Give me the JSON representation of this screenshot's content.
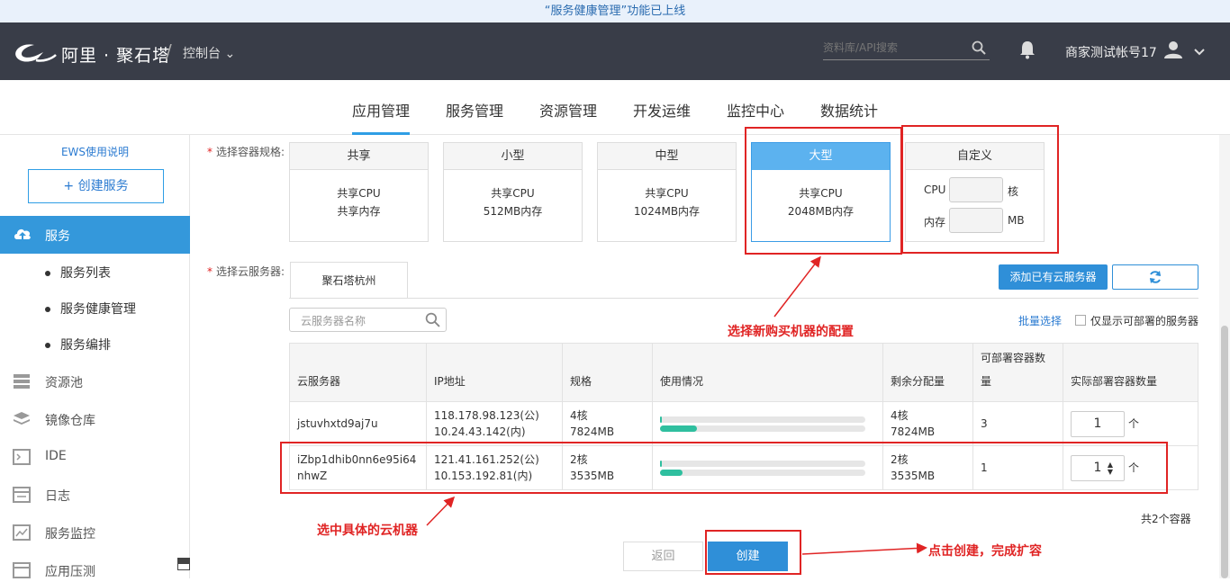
{
  "notice": "“服务健康管理”功能已上线",
  "header": {
    "brand": "阿里 · 聚石塔",
    "separator": "/",
    "console": "控制台",
    "search_placeholder": "资料库/API搜索",
    "account": "商家测试帐号17",
    "icons": [
      "alibaba-logo",
      "chevron-down-icon",
      "search-icon",
      "bell-icon",
      "user-icon",
      "chevron-down-icon"
    ]
  },
  "nav": {
    "tabs": [
      "应用管理",
      "服务管理",
      "资源管理",
      "开发运维",
      "监控中心",
      "数据统计"
    ],
    "active": "应用管理"
  },
  "sidebar": {
    "ews_link": "EWS使用说明",
    "create_button": "+ 创建服务",
    "service": "服务",
    "sub_items": [
      "服务列表",
      "服务健康管理",
      "服务编排"
    ],
    "items": [
      "资源池",
      "镜像仓库",
      "IDE",
      "日志",
      "服务监控",
      "应用压测"
    ]
  },
  "spec": {
    "label": "选择容器规格:",
    "cards": [
      {
        "title": "共享",
        "line1": "共享CPU",
        "line2": "共享内存"
      },
      {
        "title": "小型",
        "line1": "共享CPU",
        "line2": "512MB内存"
      },
      {
        "title": "中型",
        "line1": "共享CPU",
        "line2": "1024MB内存"
      },
      {
        "title": "大型",
        "line1": "共享CPU",
        "line2": "2048MB内存"
      }
    ],
    "selected": "大型",
    "custom": {
      "title": "自定义",
      "cpu_label": "CPU",
      "cpu_unit": "核",
      "mem_label": "内存",
      "mem_unit": "MB"
    }
  },
  "servers": {
    "label": "选择云服务器:",
    "tab": "聚石塔杭州",
    "add_button": "添加已有云服务器",
    "search_placeholder": "云服务器名称",
    "batch": "批量选择",
    "only_deployable": "仅显示可部署的服务器",
    "columns": [
      "云服务器",
      "IP地址",
      "规格",
      "使用情况",
      "剩余分配量",
      "可部署容器数量",
      "实际部署容器数量"
    ],
    "rows": [
      {
        "name": "jstuvhxtd9aj7u",
        "ip_public": "118.178.98.123(公)",
        "ip_private": "10.24.43.142(内)",
        "cores": "4核",
        "memory": "7824MB",
        "usage_cpu": 0.01,
        "usage_mem": 0.18,
        "remain_cores": "4核",
        "remain_memory": "7824MB",
        "deployable": "3",
        "actual": "1",
        "unit": "个"
      },
      {
        "name": "iZbp1dhib0nn6e95i64nhwZ",
        "ip_public": "121.41.161.252(公)",
        "ip_private": "10.153.192.81(内)",
        "cores": "2核",
        "memory": "3535MB",
        "usage_cpu": 0.01,
        "usage_mem": 0.11,
        "remain_cores": "2核",
        "remain_memory": "3535MB",
        "deployable": "1",
        "actual": "1",
        "unit": "个"
      }
    ],
    "total": "共2个容器"
  },
  "buttons": {
    "back": "返回",
    "create": "创建"
  },
  "annotations": {
    "select_config": "选择新购买机器的配置",
    "select_server": "选中具体的云机器",
    "click_create": "点击创建，完成扩容"
  },
  "colors": {
    "accent": "#2f8fd8",
    "header_bg": "#393d48",
    "annotation": "#e02424",
    "usage_fill": "#2fbf9f"
  }
}
